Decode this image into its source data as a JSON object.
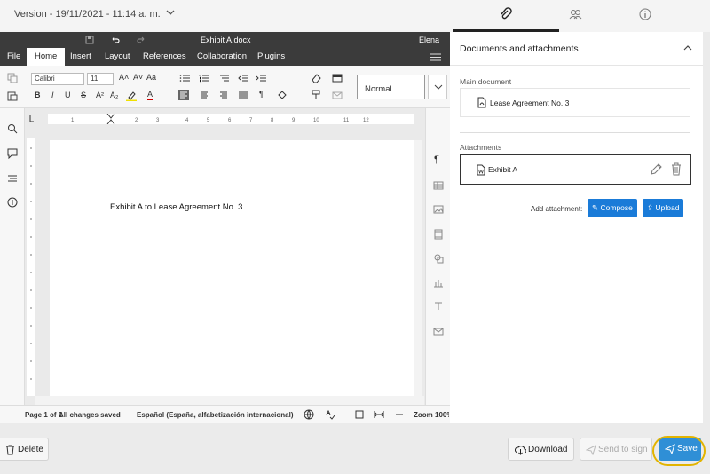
{
  "header": {
    "version_label": "Version - 19/11/2021 - 11:14 a. m.",
    "tabs": [
      {
        "icon": "paperclip-icon",
        "active": true
      },
      {
        "icon": "people-icon",
        "active": false
      },
      {
        "icon": "info-icon",
        "active": false
      }
    ]
  },
  "editor": {
    "doc_title": "Exhibit A.docx",
    "user": "Elena",
    "menu": [
      "File",
      "Home",
      "Insert",
      "Layout",
      "References",
      "Collaboration",
      "Plugins"
    ],
    "active_menu": "Home",
    "font_name": "Calibri",
    "font_size": "11",
    "style": "Normal",
    "document_text": "Exhibit A to Lease Agreement No. 3...",
    "ruler_labels": [
      "1",
      "2",
      "3",
      "4",
      "5",
      "6",
      "7",
      "8",
      "9",
      "10",
      "11",
      "12"
    ],
    "status": {
      "page_info": "Page 1 of 1",
      "save_state": "All changes saved",
      "language": "Español (España, alfabetización internacional)",
      "zoom": "Zoom 100%"
    }
  },
  "panel": {
    "title": "Documents and attachments",
    "main_document_label": "Main document",
    "main_document_name": "Lease Agreement No. 3",
    "attachments_label": "Attachments",
    "attachment_name": "Exhibit A",
    "add_attachment_label": "Add attachment:",
    "compose_label": "Compose",
    "upload_label": "Upload"
  },
  "footer": {
    "delete_label": "Delete",
    "download_label": "Download",
    "send_to_sign_label": "Send to sign",
    "save_label": "Save"
  },
  "colors": {
    "accent": "#1a7bd8",
    "save": "#2f8fd6",
    "highlight_ring": "#e2b400",
    "editor_dark": "#3b3b3b"
  }
}
